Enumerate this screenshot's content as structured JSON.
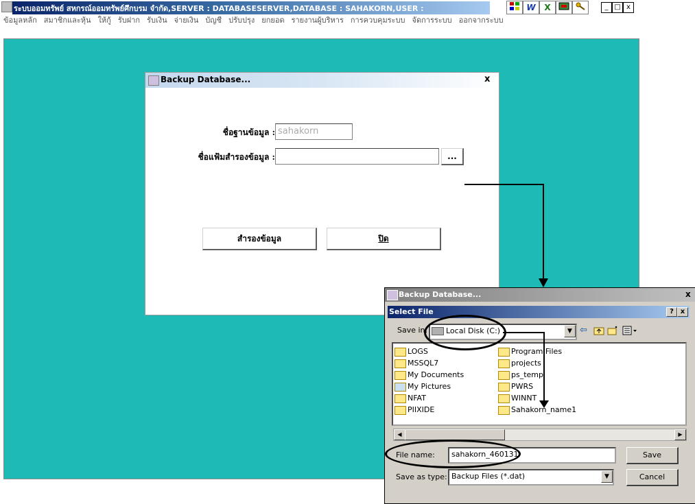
{
  "app": {
    "title": "ระบบออมทรัพย์ สหกรณ์ออมทรัพย์ศึกบรม จำกัด,SERVER : DATABASESERVER,DATABASE : SAHAKORN,USER :",
    "toolbar_icons": [
      "grid-icon",
      "word-icon",
      "excel-icon",
      "mail-icon",
      "key-icon"
    ],
    "toolbar_labels": [
      "W",
      "X"
    ],
    "window_buttons": [
      "_",
      "□",
      "x"
    ],
    "menu": [
      "ข้อมูลหลัก",
      "สมาชิกและหุ้น",
      "ให้กู้",
      "รับฝาก",
      "รับเงิน",
      "จ่ายเงิน",
      "บัญชี",
      "ปรับปรุง",
      "ยกยอด",
      "รายงานผู้บริหาร",
      "การควบคุมระบบ",
      "จัดการระบบ",
      "ออกจากระบบ"
    ],
    "desktop_color": "#1ebab5"
  },
  "backup_dialog": {
    "title": "Backup Database...",
    "close": "x",
    "db_name_label": "ชื่อฐานข้อมูล :",
    "db_name_value": "sahakorn",
    "backup_file_label": "ชื่อแฟ้มสำรองข้อมูล :",
    "backup_file_value": "",
    "browse_label": "...",
    "backup_button": "สำรองข้อมูล",
    "close_button": "ปิด"
  },
  "select_file_dialog": {
    "outer_title": "Backup Database...",
    "outer_close": "x",
    "title": "Select File",
    "help": "?",
    "close": "x",
    "save_in_label": "Save in:",
    "save_in_value": "Local Disk (C:)",
    "folders_left": [
      "LOGS",
      "MSSQL7",
      "My Documents",
      "My Pictures",
      "NFAT",
      "PIIXIDE"
    ],
    "folders_right": [
      "Program Files",
      "projects",
      "ps_temp",
      "PWRS",
      "WINNT",
      "Sahakorn_name1"
    ],
    "file_name_label": "File name:",
    "file_name_value": "sahakorn_460131",
    "save_as_type_label": "Save as type:",
    "save_as_type_value": "Backup Files (*.dat)",
    "save_button": "Save",
    "cancel_button": "Cancel"
  }
}
